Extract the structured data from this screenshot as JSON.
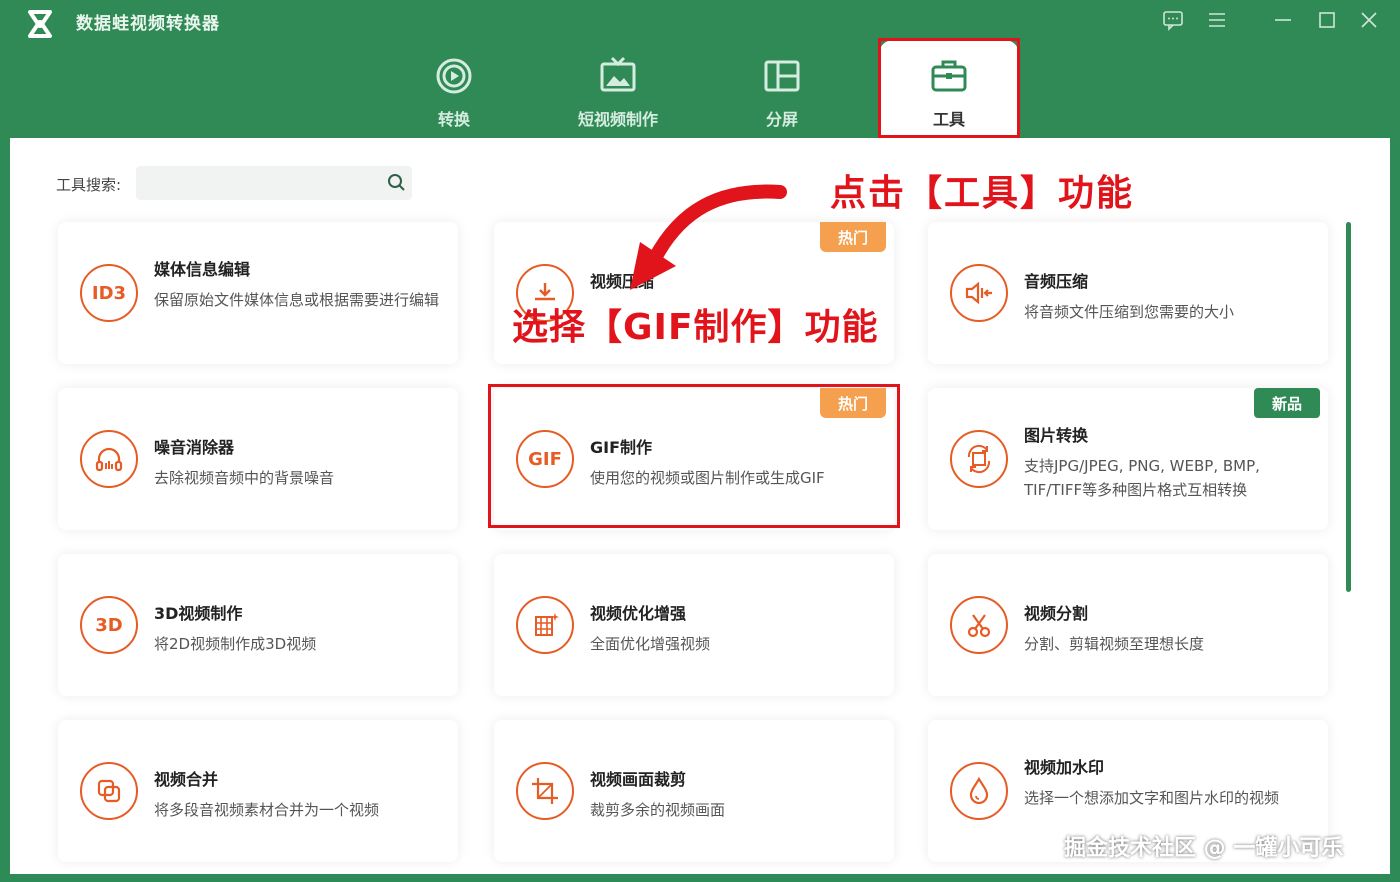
{
  "app": {
    "title": "数据蛙视频转换器"
  },
  "nav": {
    "tabs": [
      {
        "label": "转换"
      },
      {
        "label": "短视频制作"
      },
      {
        "label": "分屏"
      },
      {
        "label": "工具"
      }
    ]
  },
  "search": {
    "label": "工具搜索:",
    "value": ""
  },
  "cards": [
    {
      "icon": "ID3",
      "title": "媒体信息编辑",
      "desc": "保留原始文件媒体信息或根据需要进行编辑"
    },
    {
      "icon": "video-compress-icon",
      "title": "视频压缩",
      "badge": "热门"
    },
    {
      "icon": "audio-compress-icon",
      "title": "音频压缩",
      "desc": "将音频文件压缩到您需要的大小"
    },
    {
      "icon": "noise-remove-icon",
      "title": "噪音消除器",
      "desc": "去除视频音频中的背景噪音"
    },
    {
      "icon": "GIF",
      "title": "GIF制作",
      "desc": "使用您的视频或图片制作或生成GIF",
      "badge": "热门"
    },
    {
      "icon": "image-convert-icon",
      "title": "图片转换",
      "desc": "支持JPG/JPEG, PNG, WEBP, BMP, TIF/TIFF等多种图片格式互相转换",
      "badge": "新品"
    },
    {
      "icon": "3D",
      "title": "3D视频制作",
      "desc": "将2D视频制作成3D视频"
    },
    {
      "icon": "video-enhance-icon",
      "title": "视频优化增强",
      "desc": "全面优化增强视频"
    },
    {
      "icon": "scissors-icon",
      "title": "视频分割",
      "desc": "分割、剪辑视频至理想长度"
    },
    {
      "icon": "merge-icon",
      "title": "视频合并",
      "desc": "将多段音视频素材合并为一个视频"
    },
    {
      "icon": "crop-icon",
      "title": "视频画面裁剪",
      "desc": "裁剪多余的视频画面"
    },
    {
      "icon": "watermark-drop-icon",
      "title": "视频加水印",
      "desc": "选择一个想添加文字和图片水印的视频"
    }
  ],
  "annotations": {
    "tool_hint": "点击【工具】功能",
    "gif_hint": "选择【GIF制作】功能"
  },
  "watermark": "掘金技术社区 @ 一罐小可乐",
  "colors": {
    "brand_green": "#2f8a56",
    "accent_orange": "#e65c24",
    "hot_badge": "#f4a04e",
    "annotation_red": "#e0141a"
  }
}
